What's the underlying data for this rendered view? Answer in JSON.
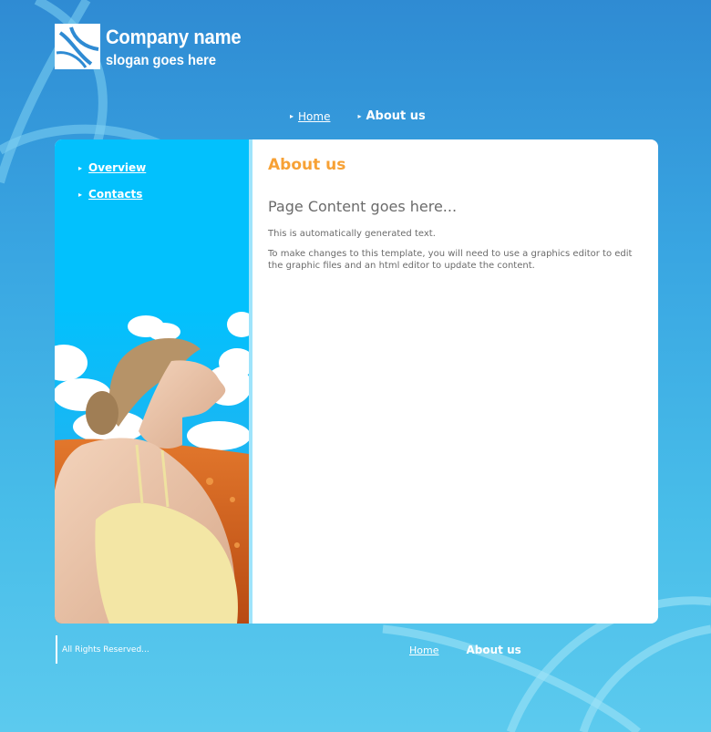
{
  "header": {
    "company_name": "Company name",
    "slogan": "slogan goes here"
  },
  "top_nav": {
    "items": [
      {
        "label": "Home",
        "active": false
      },
      {
        "label": "About us",
        "active": true
      }
    ]
  },
  "sidebar": {
    "items": [
      {
        "label": "Overview"
      },
      {
        "label": "Contacts"
      }
    ]
  },
  "content": {
    "title": "About us",
    "subtitle": "Page Content goes here...",
    "paragraphs": [
      "This is automatically generated text.",
      "To make changes to this template, you will need to use a graphics editor to edit the graphic files and an html editor to update the content."
    ]
  },
  "footer": {
    "copyright": "All Rights Reserved...",
    "nav": [
      {
        "label": "Home"
      },
      {
        "label": "About us"
      }
    ]
  },
  "colors": {
    "background_top": "#2f8bd3",
    "background_bottom": "#5ccaee",
    "sidebar": "#02c1fd",
    "title_accent": "#f7a135",
    "body_text": "#6b6b6b"
  }
}
